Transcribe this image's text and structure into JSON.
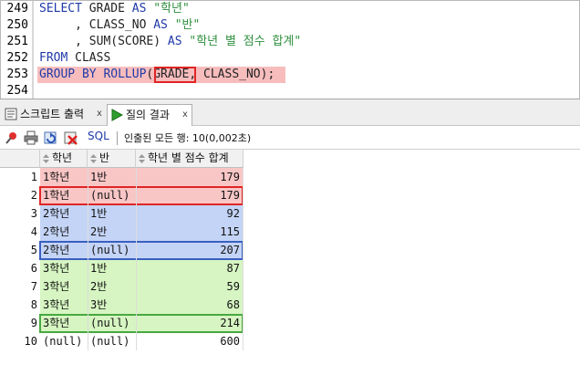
{
  "editor": {
    "lines": [
      {
        "num": "249",
        "tokens": [
          {
            "t": "SELECT",
            "c": "kw"
          },
          {
            "t": " GRADE ",
            "c": "plain"
          },
          {
            "t": "AS",
            "c": "kw"
          },
          {
            "t": " \"학년\"",
            "c": "str"
          }
        ]
      },
      {
        "num": "250",
        "tokens": [
          {
            "t": "     , CLASS_NO ",
            "c": "plain"
          },
          {
            "t": "AS",
            "c": "kw"
          },
          {
            "t": " \"반\"",
            "c": "str"
          }
        ]
      },
      {
        "num": "251",
        "tokens": [
          {
            "t": "     , SUM(SCORE) ",
            "c": "plain"
          },
          {
            "t": "AS",
            "c": "kw"
          },
          {
            "t": " \"학년 별 점수 합계\"",
            "c": "str"
          }
        ]
      },
      {
        "num": "252",
        "tokens": [
          {
            "t": "FROM",
            "c": "kw"
          },
          {
            "t": " CLASS",
            "c": "plain"
          }
        ]
      },
      {
        "num": "253",
        "tokens": [
          {
            "t": "GROUP BY ROLLUP",
            "c": "kw"
          },
          {
            "t": "(GRADE, CLASS_NO);",
            "c": "plain"
          }
        ]
      },
      {
        "num": "254",
        "tokens": []
      }
    ]
  },
  "tabs": [
    {
      "label": "스크립트 출력",
      "close": "x"
    },
    {
      "label": "질의 결과",
      "close": "x"
    }
  ],
  "toolbar": {
    "sql_label": "SQL",
    "status": "인출된 모든 행: 10(0,002초)"
  },
  "grid": {
    "columns": [
      "학년",
      "반",
      "학년 별 점수 합계"
    ],
    "rows": [
      {
        "n": "1",
        "grade": "1학년",
        "cls": "1반",
        "sum": "179"
      },
      {
        "n": "2",
        "grade": "1학년",
        "cls": "(null)",
        "sum": "179"
      },
      {
        "n": "3",
        "grade": "2학년",
        "cls": "1반",
        "sum": "92"
      },
      {
        "n": "4",
        "grade": "2학년",
        "cls": "2반",
        "sum": "115"
      },
      {
        "n": "5",
        "grade": "2학년",
        "cls": "(null)",
        "sum": "207"
      },
      {
        "n": "6",
        "grade": "3학년",
        "cls": "1반",
        "sum": "87"
      },
      {
        "n": "7",
        "grade": "3학년",
        "cls": "2반",
        "sum": "59"
      },
      {
        "n": "8",
        "grade": "3학년",
        "cls": "3반",
        "sum": "68"
      },
      {
        "n": "9",
        "grade": "3학년",
        "cls": "(null)",
        "sum": "214"
      },
      {
        "n": "10",
        "grade": "(null)",
        "cls": "(null)",
        "sum": "600"
      }
    ]
  },
  "colors": {
    "grade1": "#f9c6c6",
    "grade2": "#c4d4f6",
    "grade3": "#d6f5c2",
    "grade1_border": "#e02525",
    "grade2_border": "#3a5fc0",
    "grade3_border": "#48a840",
    "keyword": "#1f3aa8",
    "string": "#2f8f3f"
  }
}
